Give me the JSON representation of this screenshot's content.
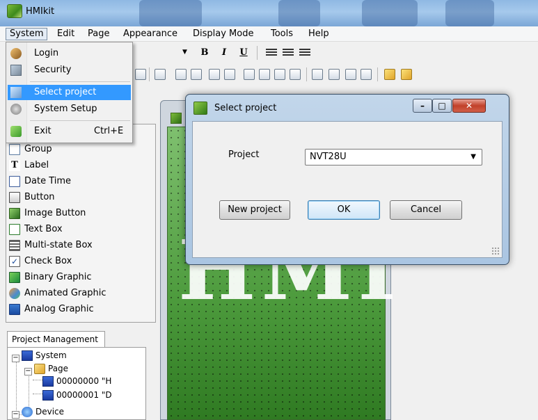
{
  "window": {
    "title": "HMIkit"
  },
  "menubar": {
    "items": [
      "System",
      "Edit",
      "Page",
      "Appearance",
      "Display Mode",
      "Tools",
      "Help"
    ]
  },
  "format_toolbar": {
    "bold": "B",
    "italic": "I",
    "underline": "U"
  },
  "system_menu": {
    "items": [
      {
        "label": "Login",
        "icon": "login-icon"
      },
      {
        "label": "Security",
        "icon": "security-icon"
      },
      {
        "label": "Select project",
        "icon": "select-project-icon",
        "highlighted": true
      },
      {
        "label": "System Setup",
        "icon": "system-setup-icon"
      },
      {
        "label": "Exit",
        "shortcut": "Ctrl+E",
        "icon": "exit-icon"
      }
    ]
  },
  "toolbox": {
    "items": [
      {
        "label": "Group",
        "icon": "group-icon"
      },
      {
        "label": "Label",
        "icon": "label-icon"
      },
      {
        "label": "Date Time",
        "icon": "date-time-icon"
      },
      {
        "label": "Button",
        "icon": "button-icon"
      },
      {
        "label": "Image Button",
        "icon": "image-button-icon"
      },
      {
        "label": "Text Box",
        "icon": "text-box-icon"
      },
      {
        "label": "Multi-state Box",
        "icon": "multi-state-box-icon"
      },
      {
        "label": "Check Box",
        "icon": "check-box-icon"
      },
      {
        "label": "Binary Graphic",
        "icon": "binary-graphic-icon"
      },
      {
        "label": "Animated Graphic",
        "icon": "animated-graphic-icon"
      },
      {
        "label": "Analog Graphic",
        "icon": "analog-graphic-icon"
      }
    ]
  },
  "project_management": {
    "tab": "Project Management",
    "tree": {
      "system": "System",
      "page": "Page",
      "pages": [
        "00000000 \"H",
        "00000001 \"D"
      ],
      "device": "Device"
    }
  },
  "canvas": {
    "text": "HMI"
  },
  "dialog": {
    "title": "Select project",
    "project_label": "Project",
    "project_value": "NVT28U",
    "new_project": "New project",
    "ok": "OK",
    "cancel": "Cancel"
  },
  "colors": {
    "highlight": "#3399ff",
    "canvas_green": "#5aa64a",
    "dialog_frame": "#aac5e2"
  }
}
